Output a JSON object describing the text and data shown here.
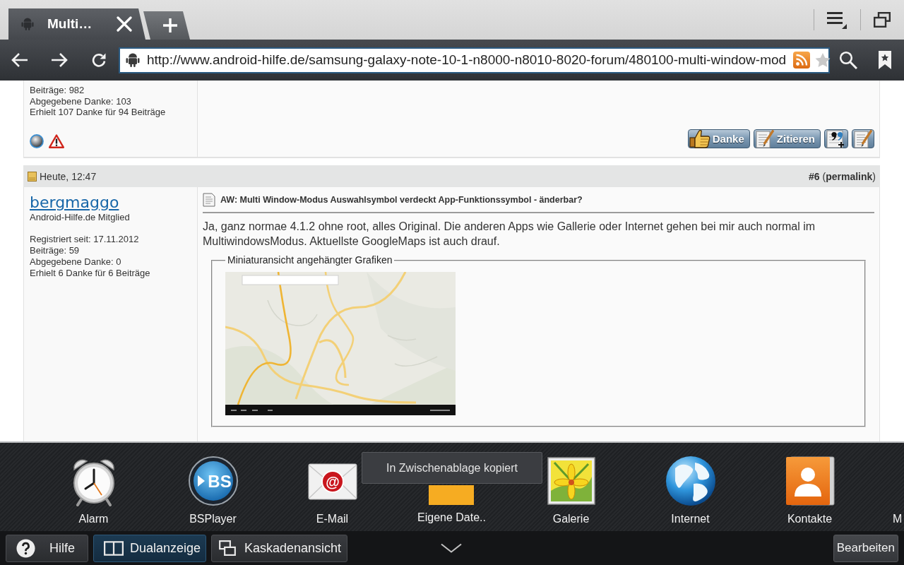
{
  "browser": {
    "tabs": [
      {
        "title": "Multi…",
        "selected": true
      }
    ],
    "url": "http://www.android-hilfe.de/samsung-galaxy-note-10-1-n8000-n8010-8020-forum/480100-multi-window-mod"
  },
  "previous_post": {
    "user_stats": [
      "Beiträge: 982",
      "Abgegebene Danke: 103",
      "Erhielt 107 Danke für 94 Beiträge"
    ],
    "buttons": [
      {
        "kind": "thanks",
        "label": "Danke"
      },
      {
        "kind": "quote",
        "label": "Zitieren"
      },
      {
        "kind": "multiquote"
      },
      {
        "kind": "edit"
      }
    ]
  },
  "post": {
    "date": "Heute, 12:47",
    "number": "#6",
    "permalink": "(**permalink**)",
    "author": "bergmaggo",
    "rank": "Android-Hilfe.de Mitglied",
    "user_stats": [
      "Registriert seit: 17.11.2012",
      "Beiträge: 59",
      "Abgegebene Danke: 0",
      "Erhielt 6 Danke für 6 Beiträge"
    ],
    "title": "AW: Multi Window-Modus Auswahlsymbol verdeckt App-Funktionssymbol - änderbar?",
    "body": "Ja, ganz normae 4.1.2 ohne root, alles Original. Die anderen Apps wie Gallerie oder Internet gehen bei mir auch normal im MultiwindowsModus. Aktuellste GoogleMaps ist auch drauf.",
    "attachments_legend": "Miniaturansicht angehängter Grafiken"
  },
  "dock": {
    "apps": [
      {
        "kind": "app",
        "label": "Alarm"
      },
      {
        "kind": "app",
        "label": "BSPlayer",
        "logo_text": "BS"
      },
      {
        "kind": "app",
        "label": "E-Mail",
        "logo_text": "@"
      },
      {
        "kind": "app",
        "label": "Eigene Date.."
      },
      {
        "kind": "app",
        "label": "Galerie"
      },
      {
        "kind": "app",
        "label": "Internet"
      },
      {
        "kind": "app",
        "label": "Kontakte"
      },
      {
        "kind": "cut_off",
        "label": "M"
      }
    ],
    "toast": "In Zwischenablage kopiert",
    "mode_buttons": [
      {
        "label": "Hilfe",
        "selected": false
      },
      {
        "label": "Dualanzeige",
        "selected": true
      },
      {
        "label": "Kaskadenansicht",
        "selected": false
      }
    ],
    "edit_button": "Bearbeiten"
  }
}
